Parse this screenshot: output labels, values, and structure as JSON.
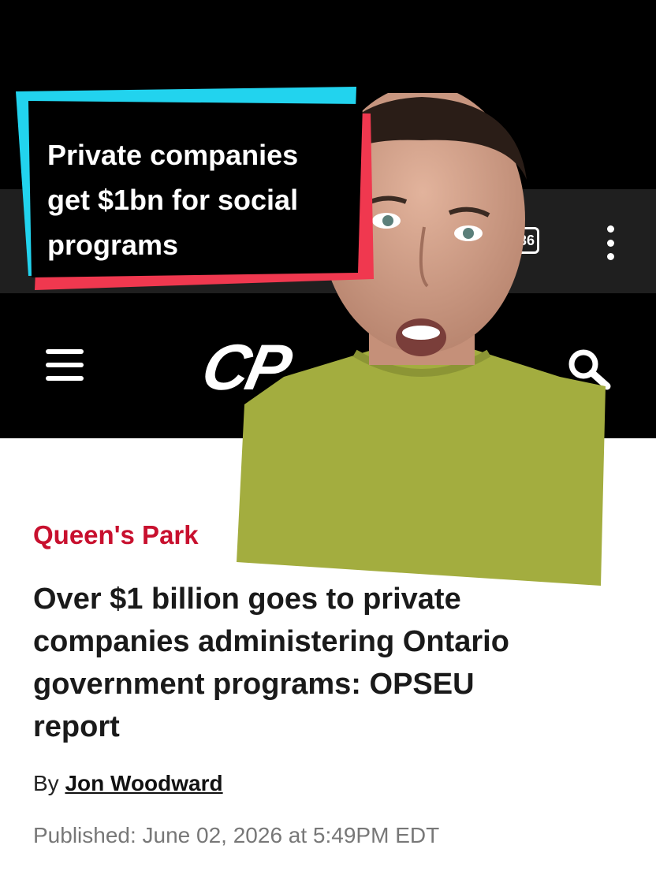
{
  "caption": {
    "line1": "Private companies",
    "line2": "get $1bn for social",
    "line3": "programs"
  },
  "browser": {
    "tab_count": "36"
  },
  "site": {
    "logo_text": "CP"
  },
  "article": {
    "section": "Queen's Park",
    "headline_line1": "Over $1 billion goes to private",
    "headline_line2": "companies administering Ontario",
    "headline_line3": "government programs: OPSEU",
    "headline_line4": "report",
    "byline_prefix": "By",
    "author": "Jon Woodward",
    "published": "Published: June 02, 2026 at 5:49PM EDT"
  },
  "icons": [
    "hamburger-menu-icon",
    "search-icon",
    "kebab-menu-icon",
    "tab-count-icon"
  ],
  "colors": {
    "caption_cyan": "#22d3ee",
    "caption_red": "#f0384f",
    "section_red": "#c8102e",
    "shirt_green": "#a3ad3f"
  }
}
